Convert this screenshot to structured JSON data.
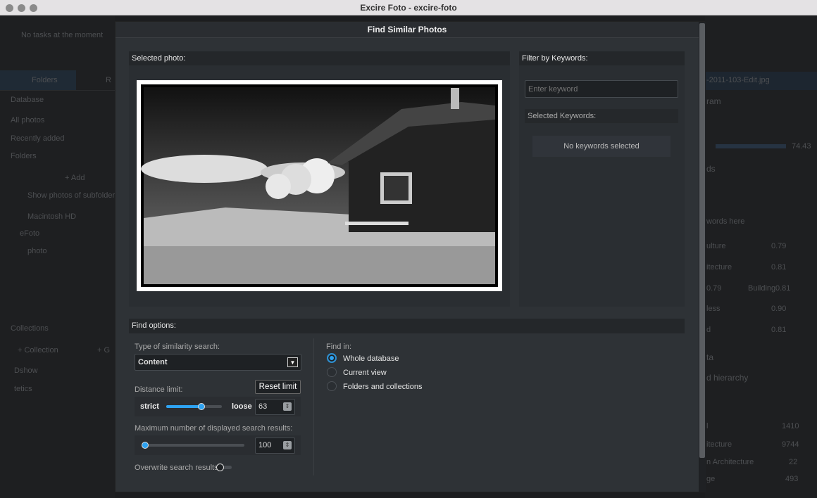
{
  "window": {
    "title": "Excire Foto - excire-foto"
  },
  "background": {
    "tasks": "No tasks at the moment",
    "tabs": [
      "Folders",
      "R"
    ],
    "sidebar": [
      "Database",
      "All photos",
      "Recently added",
      "Folders",
      "+ Add",
      "Show photos of subfolders",
      "Macintosh HD",
      "eFoto",
      "photo",
      "Collections",
      "+ Collection",
      "+ G",
      "Dshow",
      "tetics"
    ],
    "right": [
      "-2011-103-Edit.jpg",
      "ram",
      "74.43",
      "ds",
      "words here",
      "ulture",
      "0.79",
      "itecture",
      "0.81",
      "0.79",
      "Building",
      "0.81",
      "less",
      "0.90",
      "d",
      "0.81",
      "ta",
      "d hierarchy",
      "l",
      "1410",
      "itecture",
      "9744",
      "n Architecture",
      "22",
      "ge",
      "493"
    ]
  },
  "dialog": {
    "title": "Find Similar Photos",
    "selected_photo_label": "Selected photo:",
    "filter": {
      "header": "Filter by Keywords:",
      "placeholder": "Enter keyword",
      "selected_label": "Selected Keywords:",
      "empty": "No keywords selected"
    },
    "options": {
      "header": "Find options:",
      "type_label": "Type of similarity search:",
      "type_value": "Content",
      "distance_label": "Distance limit:",
      "reset": "Reset limit",
      "strict": "strict",
      "loose": "loose",
      "distance_value": "63",
      "distance_fraction": 0.63,
      "max_label": "Maximum number of displayed search results:",
      "max_value": "100",
      "max_fraction": 0.0,
      "overwrite_label": "Overwrite search results:",
      "overwrite_on": false,
      "find_in_label": "Find in:",
      "find_in": [
        "Whole database",
        "Current view",
        "Folders and collections"
      ],
      "find_in_selected": 0
    }
  },
  "colors": {
    "accent": "#2ea3f2"
  }
}
